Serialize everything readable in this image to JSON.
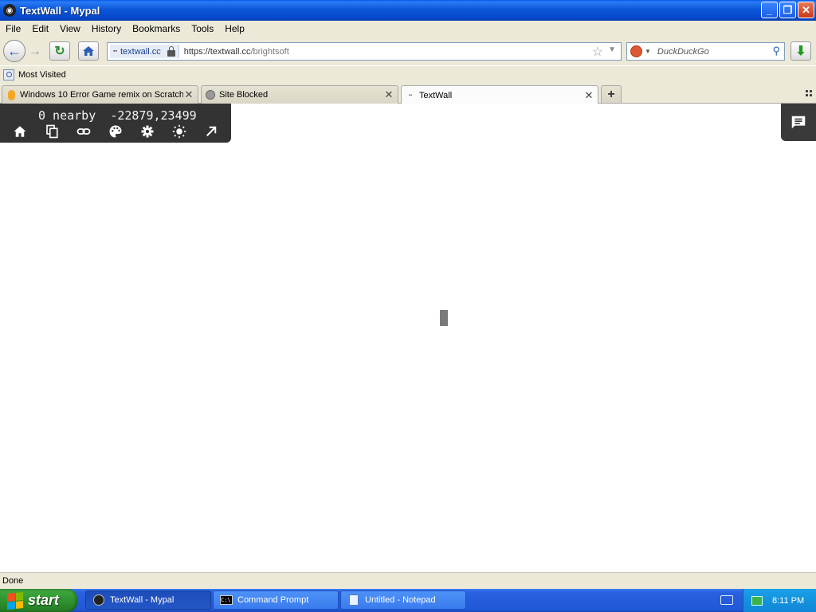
{
  "window": {
    "title": "TextWall - Mypal",
    "app_icon": "mypal-raccoon-icon"
  },
  "menu": [
    {
      "label": "File"
    },
    {
      "label": "Edit"
    },
    {
      "label": "View"
    },
    {
      "label": "History"
    },
    {
      "label": "Bookmarks"
    },
    {
      "label": "Tools"
    },
    {
      "label": "Help"
    }
  ],
  "navbar": {
    "identity_label": "textwall.cc",
    "url_host": "https://textwall.cc",
    "url_path": "/brightsoft",
    "search_placeholder": "DuckDuckGo"
  },
  "bookmarks": {
    "most_visited": "Most Visited"
  },
  "tabs": [
    {
      "label": "Windows 10 Error Game remix on Scratch",
      "icon": "scratch-icon",
      "active": false
    },
    {
      "label": "Site Blocked",
      "icon": "globe-icon",
      "active": false
    },
    {
      "label": "TextWall",
      "icon": "textwall-icon",
      "active": true
    }
  ],
  "textwall": {
    "nearby": "0 nearby",
    "coords": "-22879,23499"
  },
  "status": {
    "text": "Done"
  },
  "taskbar": {
    "start_label": "start",
    "tasks": [
      {
        "label": "TextWall - Mypal",
        "active": true
      },
      {
        "label": "Command Prompt",
        "active": false
      },
      {
        "label": "Untitled - Notepad",
        "active": false
      }
    ],
    "clock": "8:11 PM"
  },
  "colors": {
    "titlebar_blue": "#0b57d8",
    "chrome_beige": "#ece9d8",
    "panel_dark": "#333333",
    "start_green": "#3aa53a",
    "tray_blue": "#0f86d6"
  }
}
